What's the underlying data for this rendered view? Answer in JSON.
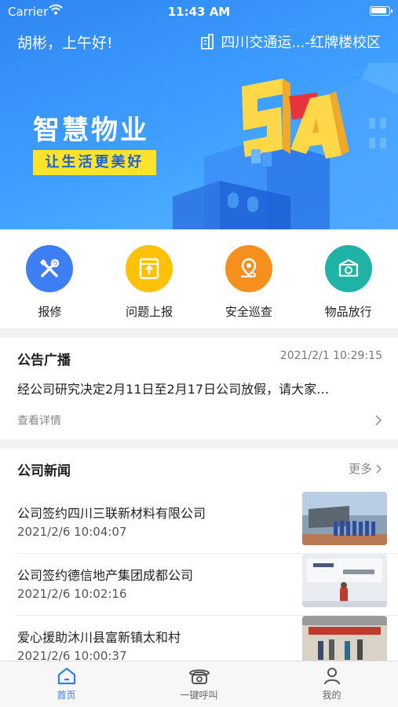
{
  "status": {
    "carrier": "Carrier",
    "time": "11:43 AM"
  },
  "header": {
    "greeting": "胡彬，上午好!",
    "campus": "四川交通运...-红牌楼校区",
    "brand_title": "智慧物业",
    "brand_tagline": "让生活更美好",
    "banner_art_text": "5A"
  },
  "actions": [
    {
      "label": "报修",
      "icon": "repair-tools-icon",
      "color": "#3d7ff2"
    },
    {
      "label": "问题上报",
      "icon": "report-box-icon",
      "color": "#ffc107"
    },
    {
      "label": "安全巡查",
      "icon": "location-pin-icon",
      "color": "#f5901e"
    },
    {
      "label": "物品放行",
      "icon": "package-icon",
      "color": "#1fb3a5"
    }
  ],
  "notice": {
    "title": "公告广播",
    "time": "2021/2/1 10:29:15",
    "text": "经公司研究决定2月11日至2月17日公司放假，请大家…",
    "more": "查看详情"
  },
  "news": {
    "title": "公司新闻",
    "more": "更多",
    "items": [
      {
        "title": "公司签约四川三联新材料有限公司",
        "date": "2021/2/6 10:04:07"
      },
      {
        "title": "公司签约德信地产集团成都公司",
        "date": "2021/2/6 10:02:16"
      },
      {
        "title": "爱心援助沐川县富新镇太和村",
        "date": "2021/2/6 10:00:37"
      }
    ]
  },
  "tabs": [
    {
      "label": "首页",
      "icon": "home-icon",
      "active": true
    },
    {
      "label": "一键呼叫",
      "icon": "phone-icon",
      "active": false
    },
    {
      "label": "我的",
      "icon": "user-icon",
      "active": false
    }
  ],
  "colors": {
    "accent": "#2f7ff0",
    "banner": "#3fa0ff",
    "tagline_bg": "#ffe22c"
  }
}
